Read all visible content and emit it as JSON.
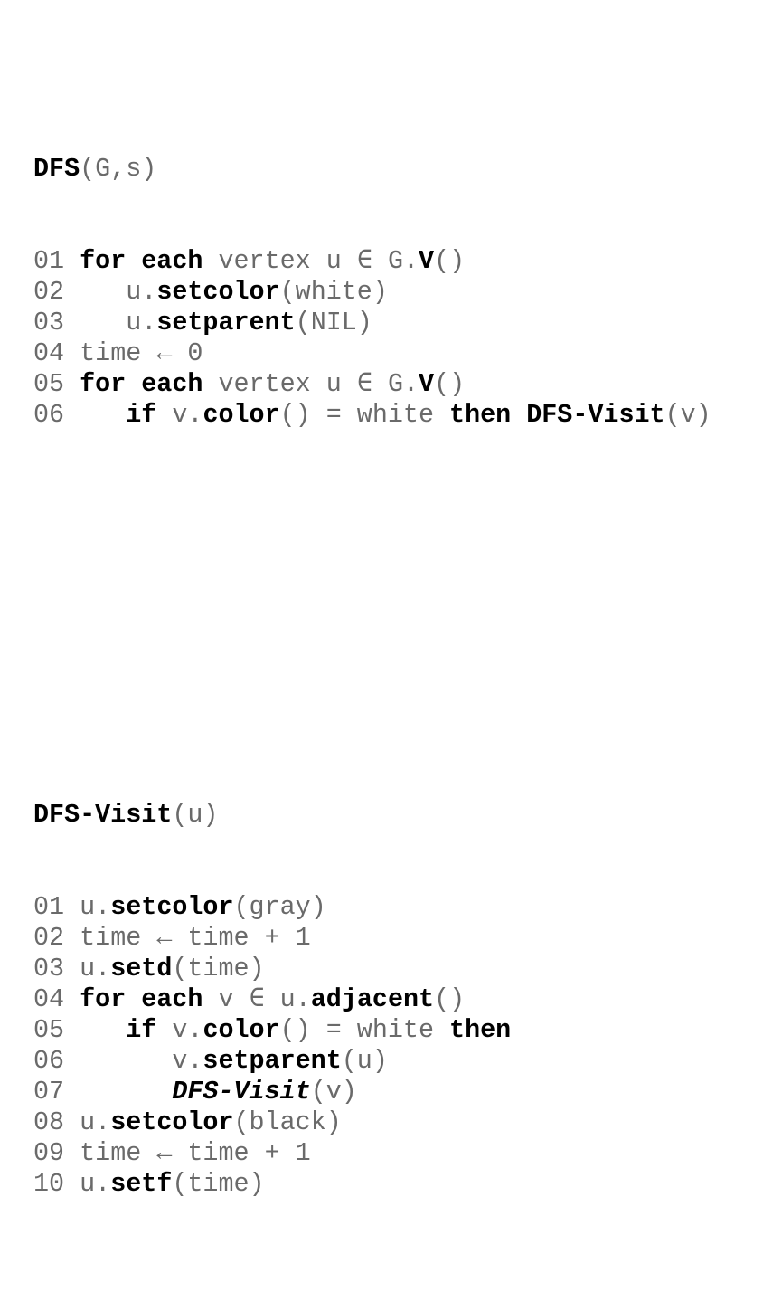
{
  "procedures": [
    {
      "header": [
        {
          "text": "DFS",
          "style": "b"
        },
        {
          "text": "(G,s)",
          "style": "n"
        }
      ],
      "lines": [
        {
          "num": "01",
          "indent": 0,
          "tokens": [
            {
              "text": "for each",
              "style": "b"
            },
            {
              "text": " vertex u ∈ G.",
              "style": "n"
            },
            {
              "text": "V",
              "style": "b"
            },
            {
              "text": "()",
              "style": "n"
            }
          ]
        },
        {
          "num": "02",
          "indent": 1,
          "tokens": [
            {
              "text": "u.",
              "style": "n"
            },
            {
              "text": "setcolor",
              "style": "b"
            },
            {
              "text": "(white)",
              "style": "n"
            }
          ]
        },
        {
          "num": "03",
          "indent": 1,
          "tokens": [
            {
              "text": "u.",
              "style": "n"
            },
            {
              "text": "setparent",
              "style": "b"
            },
            {
              "text": "(NIL)",
              "style": "n"
            }
          ]
        },
        {
          "num": "04",
          "indent": 0,
          "tokens": [
            {
              "text": "time ← 0",
              "style": "n"
            }
          ]
        },
        {
          "num": "05",
          "indent": 0,
          "tokens": [
            {
              "text": "for each",
              "style": "b"
            },
            {
              "text": " vertex u ∈ G.",
              "style": "n"
            },
            {
              "text": "V",
              "style": "b"
            },
            {
              "text": "()",
              "style": "n"
            }
          ]
        },
        {
          "num": "06",
          "indent": 1,
          "tokens": [
            {
              "text": "if",
              "style": "b"
            },
            {
              "text": " v.",
              "style": "n"
            },
            {
              "text": "color",
              "style": "b"
            },
            {
              "text": "() = white ",
              "style": "n"
            },
            {
              "text": "then DFS-Visit",
              "style": "b"
            },
            {
              "text": "(v)",
              "style": "n"
            }
          ]
        }
      ]
    },
    {
      "header": [
        {
          "text": "DFS-Visit",
          "style": "b"
        },
        {
          "text": "(u)",
          "style": "n"
        }
      ],
      "lines": [
        {
          "num": "01",
          "indent": 0,
          "tokens": [
            {
              "text": "u.",
              "style": "n"
            },
            {
              "text": "setcolor",
              "style": "b"
            },
            {
              "text": "(gray)",
              "style": "n"
            }
          ]
        },
        {
          "num": "02",
          "indent": 0,
          "tokens": [
            {
              "text": "time ← time + 1",
              "style": "n"
            }
          ]
        },
        {
          "num": "03",
          "indent": 0,
          "tokens": [
            {
              "text": "u.",
              "style": "n"
            },
            {
              "text": "setd",
              "style": "b"
            },
            {
              "text": "(time)",
              "style": "n"
            }
          ]
        },
        {
          "num": "04",
          "indent": 0,
          "tokens": [
            {
              "text": "for each",
              "style": "b"
            },
            {
              "text": " v ∈ u.",
              "style": "n"
            },
            {
              "text": "adjacent",
              "style": "b"
            },
            {
              "text": "()",
              "style": "n"
            }
          ]
        },
        {
          "num": "05",
          "indent": 1,
          "tokens": [
            {
              "text": "if",
              "style": "b"
            },
            {
              "text": " v.",
              "style": "n"
            },
            {
              "text": "color",
              "style": "b"
            },
            {
              "text": "() = white ",
              "style": "n"
            },
            {
              "text": "then",
              "style": "b"
            }
          ]
        },
        {
          "num": "06",
          "indent": 2,
          "tokens": [
            {
              "text": "v.",
              "style": "n"
            },
            {
              "text": "setparent",
              "style": "b"
            },
            {
              "text": "(u)",
              "style": "n"
            }
          ]
        },
        {
          "num": "07",
          "indent": 2,
          "tokens": [
            {
              "text": "DFS-Visit",
              "style": "bi"
            },
            {
              "text": "(v)",
              "style": "n"
            }
          ]
        },
        {
          "num": "08",
          "indent": 0,
          "tokens": [
            {
              "text": "u.",
              "style": "n"
            },
            {
              "text": "setcolor",
              "style": "b"
            },
            {
              "text": "(black)",
              "style": "n"
            }
          ]
        },
        {
          "num": "09",
          "indent": 0,
          "tokens": [
            {
              "text": "time ← time + 1",
              "style": "n"
            }
          ]
        },
        {
          "num": "10",
          "indent": 0,
          "tokens": [
            {
              "text": "u.",
              "style": "n"
            },
            {
              "text": "setf",
              "style": "b"
            },
            {
              "text": "(time)",
              "style": "n"
            }
          ]
        }
      ]
    }
  ]
}
